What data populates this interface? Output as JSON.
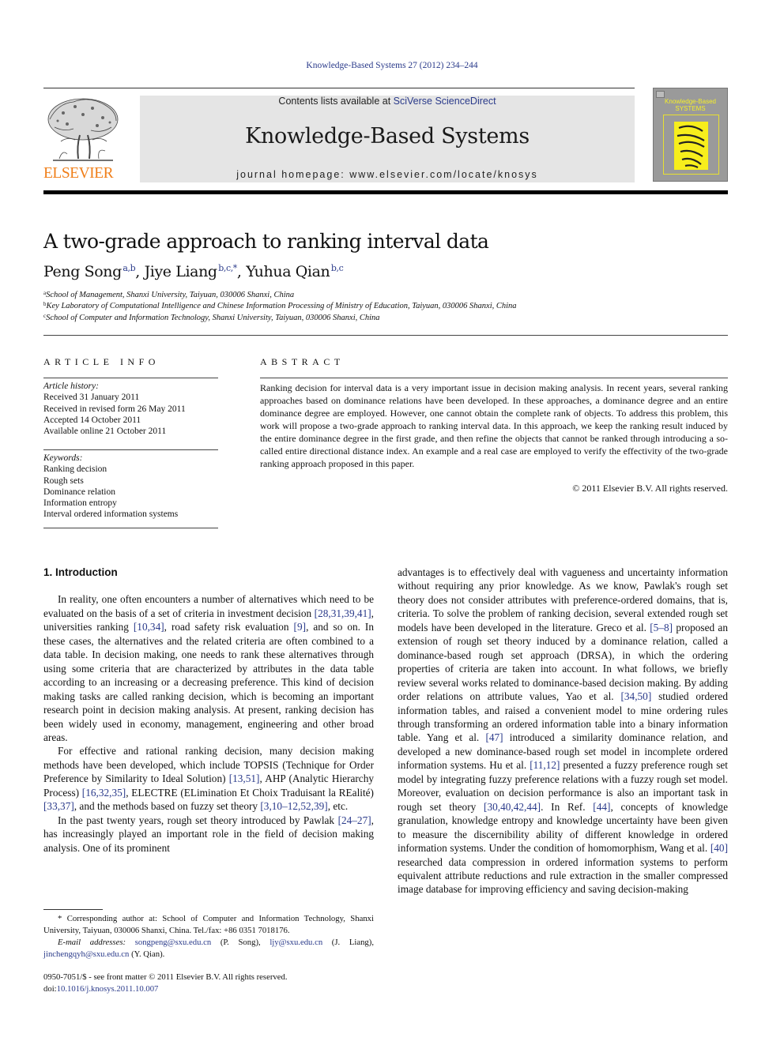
{
  "header": {
    "citation": "Knowledge-Based Systems 27 (2012) 234–244",
    "publisher_logo_text": "ELSEVIER",
    "contents_prefix": "Contents lists available at ",
    "contents_link": "SciVerse ScienceDirect",
    "journal_title": "Knowledge-Based Systems",
    "homepage": "journal homepage: www.elsevier.com/locate/knosys",
    "cover": {
      "line1": "Knowledge-Based",
      "line2": "SYSTEMS"
    }
  },
  "colors": {
    "link": "#2a3a8a",
    "elsevier_orange": "#f07f1a",
    "masthead_bg": "#e5e5e5",
    "cover_bg": "#9a9a9a",
    "cover_yellow": "#f7ee1c"
  },
  "article": {
    "title": "A two-grade approach to ranking interval data",
    "authors": [
      {
        "name": "Peng Song",
        "sup": "a,b",
        "sep": ", "
      },
      {
        "name": "Jiye Liang",
        "sup": "b,c,*",
        "sep": ", "
      },
      {
        "name": "Yuhua Qian",
        "sup": "b,c",
        "sep": ""
      }
    ],
    "affiliations": [
      {
        "key": "a",
        "text": "School of Management, Shanxi University, Taiyuan, 030006 Shanxi, China"
      },
      {
        "key": "b",
        "text": "Key Laboratory of Computational Intelligence and Chinese Information Processing of Ministry of Education, Taiyuan, 030006 Shanxi, China"
      },
      {
        "key": "c",
        "text": "School of Computer and Information Technology, Shanxi University, Taiyuan, 030006 Shanxi, China"
      }
    ]
  },
  "article_info": {
    "heading": "ARTICLE INFO",
    "history_label": "Article history:",
    "history": [
      "Received 31 January 2011",
      "Received in revised form 26 May 2011",
      "Accepted 14 October 2011",
      "Available online 21 October 2011"
    ],
    "keywords_label": "Keywords:",
    "keywords": [
      "Ranking decision",
      "Rough sets",
      "Dominance relation",
      "Information entropy",
      "Interval ordered information systems"
    ]
  },
  "abstract": {
    "heading": "ABSTRACT",
    "text": "Ranking decision for interval data is a very important issue in decision making analysis. In recent years, several ranking approaches based on dominance relations have been developed. In these approaches, a dominance degree and an entire dominance degree are employed. However, one cannot obtain the complete rank of objects. To address this problem, this work will propose a two-grade approach to ranking interval data. In this approach, we keep the ranking result induced by the entire dominance degree in the first grade, and then refine the objects that cannot be ranked through introducing a so-called entire directional distance index. An example and a real case are employed to verify the effectivity of the two-grade ranking approach proposed in this paper.",
    "copyright": "© 2011 Elsevier B.V. All rights reserved."
  },
  "body": {
    "section_heading": "1. Introduction",
    "left_paragraphs": [
      [
        {
          "t": "In reality, one often encounters a number of alternatives which need to be evaluated on the basis of a set of criteria in investment decision "
        },
        {
          "c": "[28,31,39,41]"
        },
        {
          "t": ", universities ranking "
        },
        {
          "c": "[10,34]"
        },
        {
          "t": ", road safety risk evaluation "
        },
        {
          "c": "[9]"
        },
        {
          "t": ", and so on. In these cases, the alternatives and the related criteria are often combined to a data table. In decision making, one needs to rank these alternatives through using some criteria that are characterized by attributes in the data table according to an increasing or a decreasing preference. This kind of decision making tasks are called ranking decision, which is becoming an important research point in decision making analysis. At present, ranking decision has been widely used in economy, management, engineering and other broad areas."
        }
      ],
      [
        {
          "t": "For effective and rational ranking decision, many decision making methods have been developed, which include TOPSIS (Technique for Order Preference by Similarity to Ideal Solution) "
        },
        {
          "c": "[13,51]"
        },
        {
          "t": ", AHP (Analytic Hierarchy Process) "
        },
        {
          "c": "[16,32,35]"
        },
        {
          "t": ", ELECTRE (ELimination Et Choix Traduisant la REalité) "
        },
        {
          "c": "[33,37]"
        },
        {
          "t": ", and the methods based on fuzzy set theory "
        },
        {
          "c": "[3,10–12,52,39]"
        },
        {
          "t": ", etc."
        }
      ],
      [
        {
          "t": "In the past twenty years, rough set theory introduced by Pawlak "
        },
        {
          "c": "[24–27]"
        },
        {
          "t": ", has increasingly played an important role in the field of decision making analysis. One of its prominent"
        }
      ]
    ],
    "right_paragraph": [
      {
        "t": "advantages is to effectively deal with vagueness and uncertainty information without requiring any prior knowledge. As we know, Pawlak's rough set theory does not consider attributes with preference-ordered domains, that is, criteria. To solve the problem of ranking decision, several extended rough set models have been developed in the literature. Greco et al. "
      },
      {
        "c": "[5–8]"
      },
      {
        "t": " proposed an extension of rough set theory induced by a dominance relation, called a dominance-based rough set approach (DRSA), in which the ordering properties of criteria are taken into account. In what follows, we briefly review several works related to dominance-based decision making. By adding order relations on attribute values, Yao et al. "
      },
      {
        "c": "[34,50]"
      },
      {
        "t": " studied ordered information tables, and raised a convenient model to mine ordering rules through transforming an ordered information table into a binary information table. Yang et al. "
      },
      {
        "c": "[47]"
      },
      {
        "t": " introduced a similarity dominance relation, and developed a new dominance-based rough set model in incomplete ordered information systems. Hu et al. "
      },
      {
        "c": "[11,12]"
      },
      {
        "t": " presented a fuzzy preference rough set model by integrating fuzzy preference relations with a fuzzy rough set model. Moreover, evaluation on decision performance is also an important task in rough set theory "
      },
      {
        "c": "[30,40,42,44]"
      },
      {
        "t": ". In Ref. "
      },
      {
        "c": "[44]"
      },
      {
        "t": ", concepts of knowledge granulation, knowledge entropy and knowledge uncertainty have been given to measure the discernibility ability of different knowledge in ordered information systems. Under the condition of homomorphism, Wang et al. "
      },
      {
        "c": "[40]"
      },
      {
        "t": " researched data compression in ordered information systems to perform equivalent attribute reductions and rule extraction in the smaller compressed image database for improving efficiency and saving decision-making"
      }
    ]
  },
  "footnotes": {
    "corresponding": "* Corresponding author at: School of Computer and Information Technology, Shanxi University, Taiyuan, 030006 Shanxi, China. Tel./fax: +86 0351 7018176.",
    "email_label": "E-mail addresses:",
    "emails": [
      {
        "address": "songpeng@sxu.edu.cn",
        "who": " (P. Song), "
      },
      {
        "address": "ljy@sxu.edu.cn",
        "who": " (J. Liang), "
      },
      {
        "address": "jinchengqyh@sxu.edu.cn",
        "who": " (Y. Qian)."
      }
    ],
    "front_matter": "0950-7051/$ - see front matter © 2011 Elsevier B.V. All rights reserved.",
    "doi_prefix": "doi:",
    "doi": "10.1016/j.knosys.2011.10.007"
  }
}
